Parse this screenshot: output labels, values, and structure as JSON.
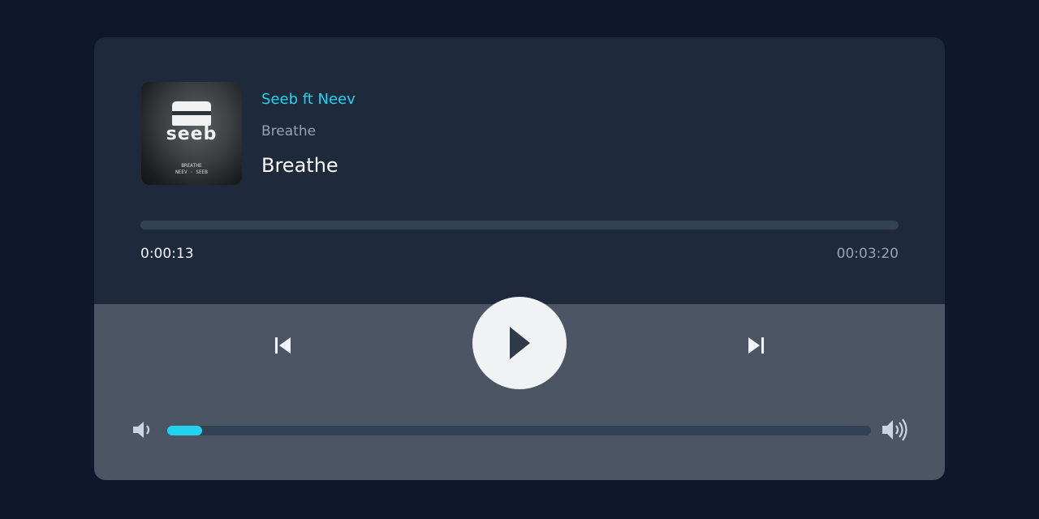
{
  "track": {
    "artist": "Seeb ft Neev",
    "album": "Breathe",
    "title": "Breathe"
  },
  "cover": {
    "logo_text": "seeb",
    "small_lines": [
      "BREATHE",
      "NEEV · SEEB"
    ]
  },
  "progress": {
    "current_time": "0:00:13",
    "total_time": "00:03:20",
    "fraction": 0.065
  },
  "volume": {
    "fraction": 0.05
  },
  "icons": {
    "previous": "skip-previous-icon",
    "play": "play-icon",
    "next": "skip-next-icon",
    "volume_low": "volume-low-icon",
    "volume_high": "volume-high-icon"
  },
  "colors": {
    "background": "#0f172a",
    "card": "#1e293b",
    "controls_panel": "#4b5563",
    "accent": "#22d3ee",
    "track": "#334155"
  }
}
